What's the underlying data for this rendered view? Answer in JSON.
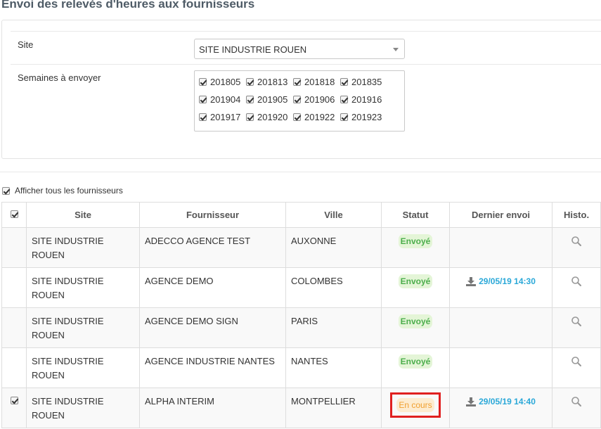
{
  "page": {
    "title": "Envoi des relevés d'heures aux fournisseurs"
  },
  "filters": {
    "site_label": "Site",
    "site_value": "SITE INDUSTRIE ROUEN",
    "weeks_label": "Semaines à envoyer",
    "weeks": [
      "201805",
      "201813",
      "201818",
      "201835",
      "201904",
      "201905",
      "201906",
      "201916",
      "201917",
      "201920",
      "201922",
      "201923"
    ]
  },
  "show_all_label": "Afficher tous les fournisseurs",
  "table": {
    "headers": {
      "site": "Site",
      "supplier": "Fournisseur",
      "city": "Ville",
      "status": "Statut",
      "last_send": "Dernier envoi",
      "history": "Histo."
    },
    "rows": [
      {
        "site_line1": "SITE INDUSTRIE",
        "site_line2": "ROUEN",
        "supplier": "ADECCO AGENCE TEST",
        "city": "AUXONNE",
        "status": "Envoyé",
        "last_send": ""
      },
      {
        "site_line1": "SITE INDUSTRIE",
        "site_line2": "ROUEN",
        "supplier": "AGENCE DEMO",
        "city": "COLOMBES",
        "status": "Envoyé",
        "last_send": "29/05/19 14:30"
      },
      {
        "site_line1": "SITE INDUSTRIE",
        "site_line2": "ROUEN",
        "supplier": "AGENCE DEMO SIGN",
        "city": "PARIS",
        "status": "Envoyé",
        "last_send": ""
      },
      {
        "site_line1": "SITE INDUSTRIE",
        "site_line2": "ROUEN",
        "supplier": "AGENCE INDUSTRIE NANTES",
        "city": "NANTES",
        "status": "Envoyé",
        "last_send": ""
      },
      {
        "site_line1": "SITE INDUSTRIE",
        "site_line2": "ROUEN",
        "supplier": "ALPHA INTERIM",
        "city": "MONTPELLIER",
        "status": "En cours",
        "last_send": "29/05/19 14:40"
      }
    ]
  },
  "colors": {
    "sent_badge": "#4cae4c",
    "in_progress_badge": "#f0a030",
    "link": "#2aa8d8",
    "highlight": "#e02020"
  },
  "icons": {
    "download": "download-icon",
    "history": "search-icon",
    "select": "caret-down-icon"
  }
}
